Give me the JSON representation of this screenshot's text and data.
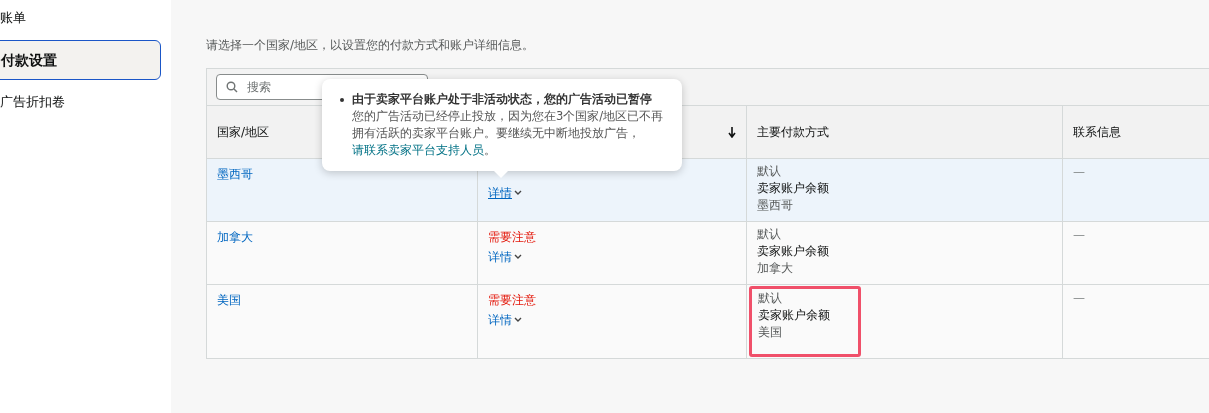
{
  "sidebar": {
    "items": [
      {
        "label": "账单",
        "selected": false
      },
      {
        "label": "付款设置",
        "selected": true
      },
      {
        "label": "广告折扣卷",
        "selected": false
      }
    ]
  },
  "description": "请选择一个国家/地区，以设置您的付款方式和账户详细信息。",
  "search": {
    "placeholder": "搜索"
  },
  "table": {
    "columns": [
      {
        "label": "国家/地区"
      },
      {
        "sorted": true
      },
      {
        "label": "主要付款方式"
      },
      {
        "label": "联系信息"
      }
    ],
    "rows": [
      {
        "country": "墨西哥",
        "details": "详情",
        "default_label": "默认",
        "method": "卖家账户余额",
        "method_country": "墨西哥",
        "contact": "—",
        "selected": true,
        "highlighted": false
      },
      {
        "country": "加拿大",
        "status": "需要注意",
        "details": "详情",
        "default_label": "默认",
        "method": "卖家账户余额",
        "method_country": "加拿大",
        "contact": "—",
        "selected": false,
        "highlighted": false
      },
      {
        "country": "美国",
        "status": "需要注意",
        "details": "详情",
        "default_label": "默认",
        "method": "卖家账户余额",
        "method_country": "美国",
        "contact": "—",
        "selected": false,
        "highlighted": true
      }
    ]
  },
  "tooltip": {
    "title": "由于卖家平台账户处于非活动状态，您的广告活动已暂停",
    "body": "您的广告活动已经停止投放，因为您在3个国家/地区已不再拥有活跃的卖家平台账户。要继续无中断地投放广告，",
    "link": "请联系卖家平台支持人员",
    "end": "。"
  }
}
